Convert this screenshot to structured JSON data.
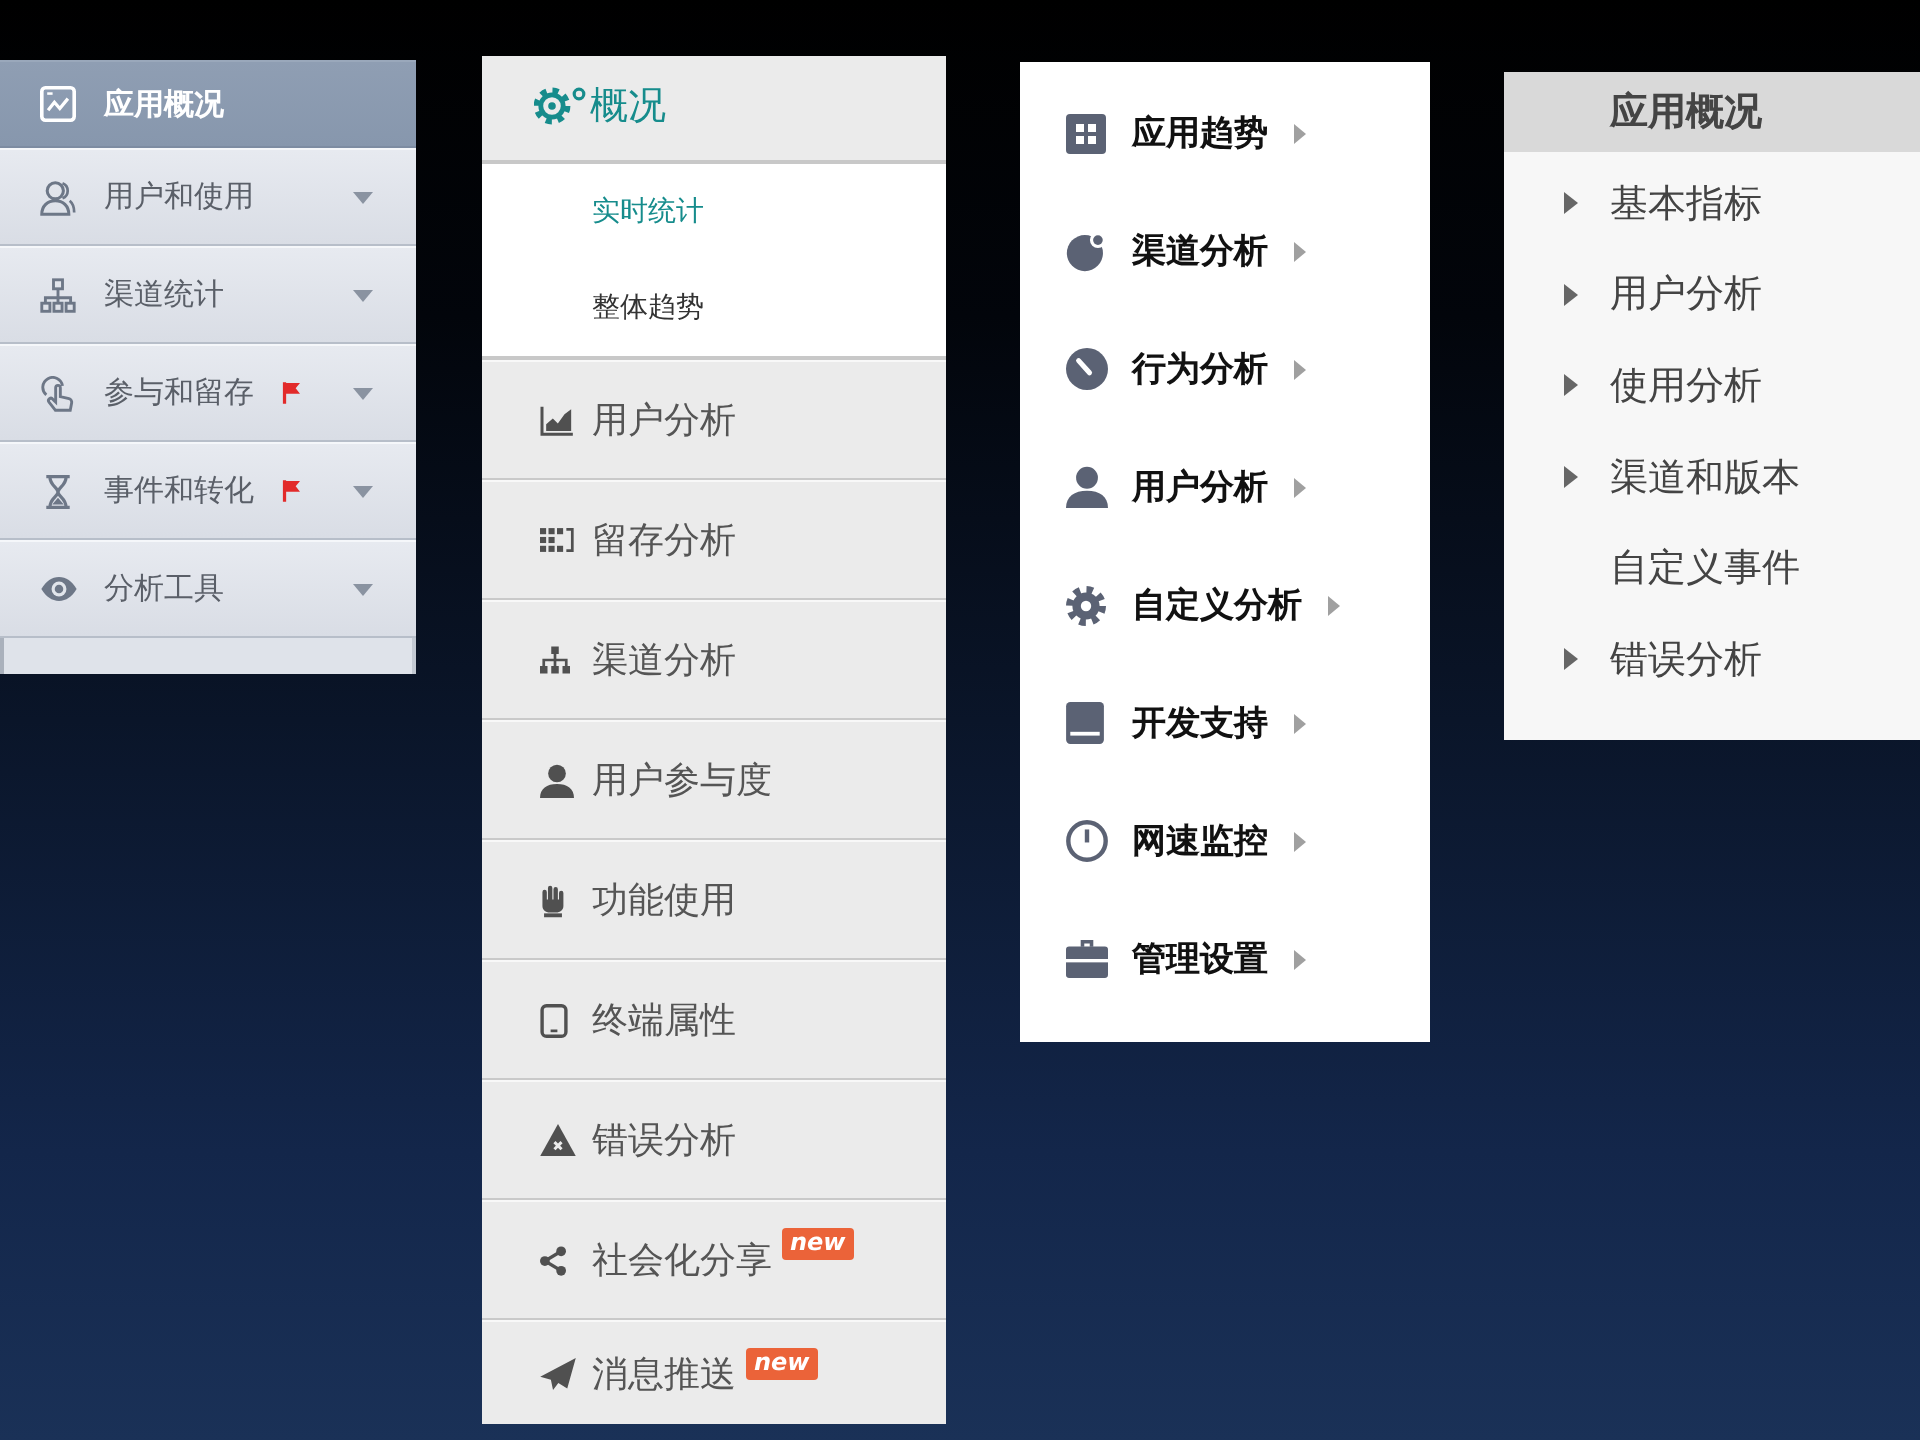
{
  "sidebar_1": {
    "items": [
      {
        "label": "应用概况",
        "selected": true,
        "expandable": false,
        "flagged": false
      },
      {
        "label": "用户和使用",
        "selected": false,
        "expandable": true,
        "flagged": false
      },
      {
        "label": "渠道统计",
        "selected": false,
        "expandable": true,
        "flagged": false
      },
      {
        "label": "参与和留存",
        "selected": false,
        "expandable": true,
        "flagged": true
      },
      {
        "label": "事件和转化",
        "selected": false,
        "expandable": true,
        "flagged": true
      },
      {
        "label": "分析工具",
        "selected": false,
        "expandable": true,
        "flagged": false
      }
    ]
  },
  "sidebar_2": {
    "section": {
      "title": "概况",
      "children": [
        {
          "label": "实时统计",
          "selected": true
        },
        {
          "label": "整体趋势",
          "selected": false
        }
      ]
    },
    "items": [
      {
        "label": "用户分析"
      },
      {
        "label": "留存分析"
      },
      {
        "label": "渠道分析"
      },
      {
        "label": "用户参与度"
      },
      {
        "label": "功能使用"
      },
      {
        "label": "终端属性"
      },
      {
        "label": "错误分析"
      },
      {
        "label": "社会化分享",
        "badge": "new"
      },
      {
        "label": "消息推送",
        "badge": "new"
      }
    ]
  },
  "sidebar_3": {
    "items": [
      {
        "label": "应用趋势"
      },
      {
        "label": "渠道分析"
      },
      {
        "label": "行为分析"
      },
      {
        "label": "用户分析"
      },
      {
        "label": "自定义分析"
      },
      {
        "label": "开发支持"
      },
      {
        "label": "网速监控"
      },
      {
        "label": "管理设置"
      }
    ]
  },
  "sidebar_4": {
    "title": "应用概况",
    "items": [
      {
        "label": "基本指标",
        "expandable": true
      },
      {
        "label": "用户分析",
        "expandable": true
      },
      {
        "label": "使用分析",
        "expandable": true
      },
      {
        "label": "渠道和版本",
        "expandable": true
      },
      {
        "label": "自定义事件",
        "expandable": false
      },
      {
        "label": "错误分析",
        "expandable": true
      }
    ]
  }
}
